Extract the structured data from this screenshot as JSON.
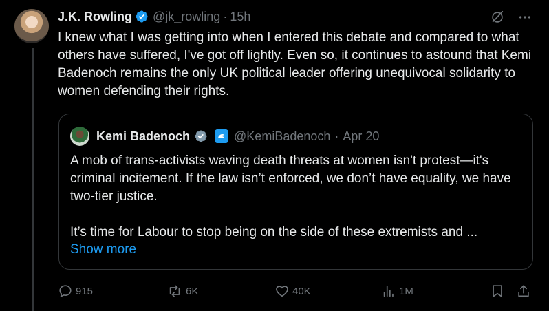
{
  "tweet": {
    "author_name": "J.K. Rowling",
    "handle": "@jk_rowling",
    "separator": "·",
    "time": "15h",
    "text": "I knew what I was getting into when I entered this debate and compared to what others have suffered, I've got off lightly. Even so, it continues to astound that Kemi Badenoch remains the only UK political leader offering unequivocal solidarity to women defending their rights."
  },
  "quote": {
    "author_name": "Kemi Badenoch",
    "handle": "@KemiBadenoch",
    "separator": "·",
    "date": "Apr 20",
    "paragraph1": "A mob of trans-activists waving death threats at women isn't protest—it's criminal incitement. If the law isn’t enforced, we don’t have equality, we have two-tier justice.",
    "paragraph2": "It’s time for Labour to stop being on the side of these extremists and ...",
    "show_more": "Show more"
  },
  "actions": {
    "replies": "915",
    "reposts": "6K",
    "likes": "40K",
    "views": "1M"
  },
  "icons": [
    "grok-icon",
    "more-icon",
    "verified-icon",
    "affiliate-badge-icon",
    "reply-icon",
    "repost-icon",
    "like-icon",
    "views-icon",
    "bookmark-icon",
    "share-icon"
  ],
  "colors": {
    "accent": "#1d9bf0",
    "muted": "#71767b",
    "text": "#e7e9ea",
    "border": "#333639"
  }
}
